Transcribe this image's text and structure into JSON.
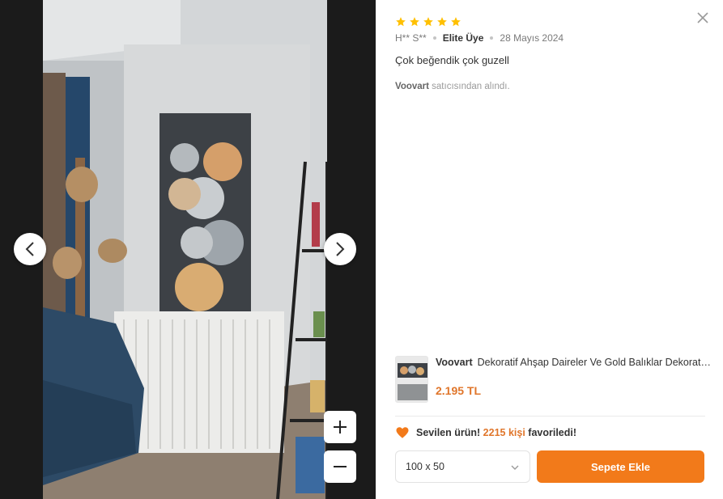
{
  "review": {
    "rating": 5,
    "author": "H** S**",
    "badge": "Elite Üye",
    "date": "28 Mayıs 2024",
    "comment": "Çok beğendik çok guzell",
    "seller_name": "Voovart",
    "seller_suffix": " satıcısından alındı."
  },
  "product": {
    "brand": "Voovart",
    "title": "Dekoratif Ahşap Daireler Ve Gold Balıklar Dekoratif Kanvas Tablo",
    "price": "2.195 TL"
  },
  "favorites": {
    "prefix": "Sevilen ürün!",
    "count": "2215 kişi",
    "suffix": "favoriledi!"
  },
  "size_select": {
    "value": "100 x 50"
  },
  "cart_button": {
    "label": "Sepete Ekle"
  },
  "icons": {
    "star": "star-icon",
    "close": "close-icon",
    "prev": "chevron-left-icon",
    "next": "chevron-right-icon",
    "zoom_in": "plus-icon",
    "zoom_out": "minus-icon",
    "heart": "heart-icon",
    "chevron": "chevron-down-icon"
  },
  "colors": {
    "accent": "#f27a1a",
    "price": "#e0762b",
    "star": "#ffc000"
  }
}
